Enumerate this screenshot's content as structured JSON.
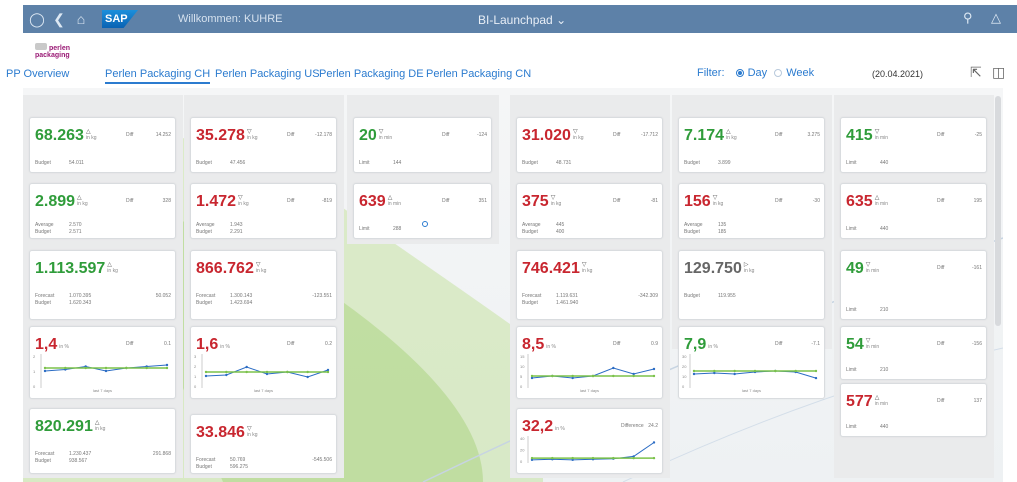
{
  "shell": {
    "welcome": "Willkommen: KUHRE",
    "app_title": "BI-Launchpad",
    "logo": "SAP"
  },
  "brand": {
    "line1": "perlen",
    "line2": "packaging"
  },
  "tabs": [
    "PP Overview",
    "Perlen Packaging CH",
    "Perlen Packaging US",
    "Perlen Packaging DE",
    "Perlen Packaging CN"
  ],
  "filter": {
    "label": "Filter:",
    "day": "Day",
    "week": "Week",
    "selected": "Day"
  },
  "date": "(20.04.2021)",
  "labels": {
    "diff": "Diff",
    "difference": "Difference",
    "budget": "Budget",
    "average": "Average",
    "forecast": "Forecast",
    "limit": "Limit",
    "last7": "last 7 days",
    "in_kg": "in kg",
    "in_min": "in min",
    "in_pct": "in %"
  },
  "tiles": {
    "c1t1": {
      "value": "68.263",
      "diff": "14.252",
      "budget": "54.011"
    },
    "c1t2": {
      "value": "2.899",
      "diff": "328",
      "average": "2.570",
      "budget": "2.571"
    },
    "c1t3": {
      "value": "1.113.597",
      "forecast": "1.070.395",
      "budget": "1.620.343",
      "fdiff": "50.052"
    },
    "c1t4": {
      "value": "1,4",
      "diff": "0.1",
      "y": [
        "2",
        "1",
        "0"
      ]
    },
    "c1t5": {
      "value": "820.291",
      "forecast": "1.230.437",
      "budget": "938.567",
      "fdiff": "291.868"
    },
    "c2t1": {
      "value": "35.278",
      "diff": "-12.178",
      "budget": "47.456"
    },
    "c2t2": {
      "value": "1.472",
      "diff": "-819",
      "average": "1.943",
      "budget": "2.291"
    },
    "c2t3": {
      "value": "866.762",
      "forecast": "1.300.143",
      "budget": "1.423.694",
      "fdiff": "-123.551"
    },
    "c2t4": {
      "value": "1,6",
      "diff": "0.2",
      "y": [
        "3",
        "2",
        "1",
        "0"
      ]
    },
    "c2t5": {
      "value": "33.846",
      "forecast": "50.769",
      "budget": "596.275",
      "fdiff": "-545.506"
    },
    "c3t1": {
      "value": "20",
      "diff": "-124",
      "limit": "144"
    },
    "c3t2": {
      "value": "639",
      "diff": "351",
      "limit": "288"
    },
    "c4t1": {
      "value": "31.020",
      "diff": "-17.712",
      "budget": "48.731"
    },
    "c4t2": {
      "value": "375",
      "diff": "-81",
      "average": "445",
      "budget": "400"
    },
    "c4t3": {
      "value": "746.421",
      "forecast": "1.119.631",
      "budget": "1.461.940",
      "fdiff": "-342.309"
    },
    "c4t4": {
      "value": "8,5",
      "diff": "0.9",
      "y": [
        "15",
        "10",
        "5",
        "0"
      ]
    },
    "c4t5": {
      "value": "32,2",
      "diff": "24.2",
      "y": [
        "40",
        "20",
        "0"
      ]
    },
    "c5t1": {
      "value": "7.174",
      "diff": "3.275",
      "budget": "3.899"
    },
    "c5t2": {
      "value": "156",
      "diff": "-30",
      "average": "135",
      "budget": "185"
    },
    "c5t3": {
      "value": "129.750",
      "budget": "119.955"
    },
    "c5t4": {
      "value": "7,9",
      "diff": "-7.1",
      "y": [
        "30",
        "20",
        "10",
        "0"
      ]
    },
    "c6t1": {
      "value": "415",
      "diff": "-25",
      "limit": "440"
    },
    "c6t2": {
      "value": "635",
      "diff": "195",
      "limit": "440"
    },
    "c6t3": {
      "value": "49",
      "diff": "-161",
      "limit": "210"
    },
    "c6t4": {
      "value": "54",
      "diff": "-156",
      "limit": "210"
    },
    "c6t5": {
      "value": "577",
      "diff": "137",
      "limit": "440"
    }
  },
  "chart_data": [
    {
      "type": "line",
      "tile": "c1t4",
      "series": [
        {
          "values": [
            1.0,
            1.1,
            1.3,
            1.0,
            1.2,
            1.3,
            1.4
          ]
        },
        {
          "values": [
            1.2,
            1.2,
            1.2,
            1.2,
            1.2,
            1.2,
            1.2
          ]
        }
      ],
      "ylim": [
        0,
        2
      ]
    },
    {
      "type": "line",
      "tile": "c2t4",
      "series": [
        {
          "values": [
            1.0,
            1.1,
            1.9,
            1.2,
            1.4,
            0.9,
            1.6
          ]
        },
        {
          "values": [
            1.4,
            1.4,
            1.4,
            1.4,
            1.4,
            1.4,
            1.4
          ]
        }
      ],
      "ylim": [
        0,
        3
      ]
    },
    {
      "type": "line",
      "tile": "c4t4",
      "series": [
        {
          "values": [
            4,
            5,
            4,
            5,
            9,
            6,
            8.5
          ]
        },
        {
          "values": [
            5,
            5,
            5,
            5,
            5,
            5,
            5
          ]
        }
      ],
      "ylim": [
        0,
        15
      ]
    },
    {
      "type": "line",
      "tile": "c4t5",
      "series": [
        {
          "values": [
            2,
            3,
            2,
            3,
            4,
            8,
            32.2
          ]
        },
        {
          "values": [
            5,
            5,
            5,
            5,
            5,
            5,
            5
          ]
        }
      ],
      "ylim": [
        0,
        40
      ]
    },
    {
      "type": "line",
      "tile": "c5t4",
      "series": [
        {
          "values": [
            12,
            13,
            12,
            14,
            15,
            14,
            7.9
          ]
        },
        {
          "values": [
            15,
            15,
            15,
            15,
            15,
            15,
            15
          ]
        }
      ],
      "ylim": [
        0,
        30
      ]
    }
  ],
  "colors": {
    "shell": "#5d81a8",
    "green": "#2f9c3a",
    "red": "#c8262f",
    "link": "#2b7bcf",
    "budget_line": "#7bc24a",
    "actual_line": "#2b6cc4"
  }
}
